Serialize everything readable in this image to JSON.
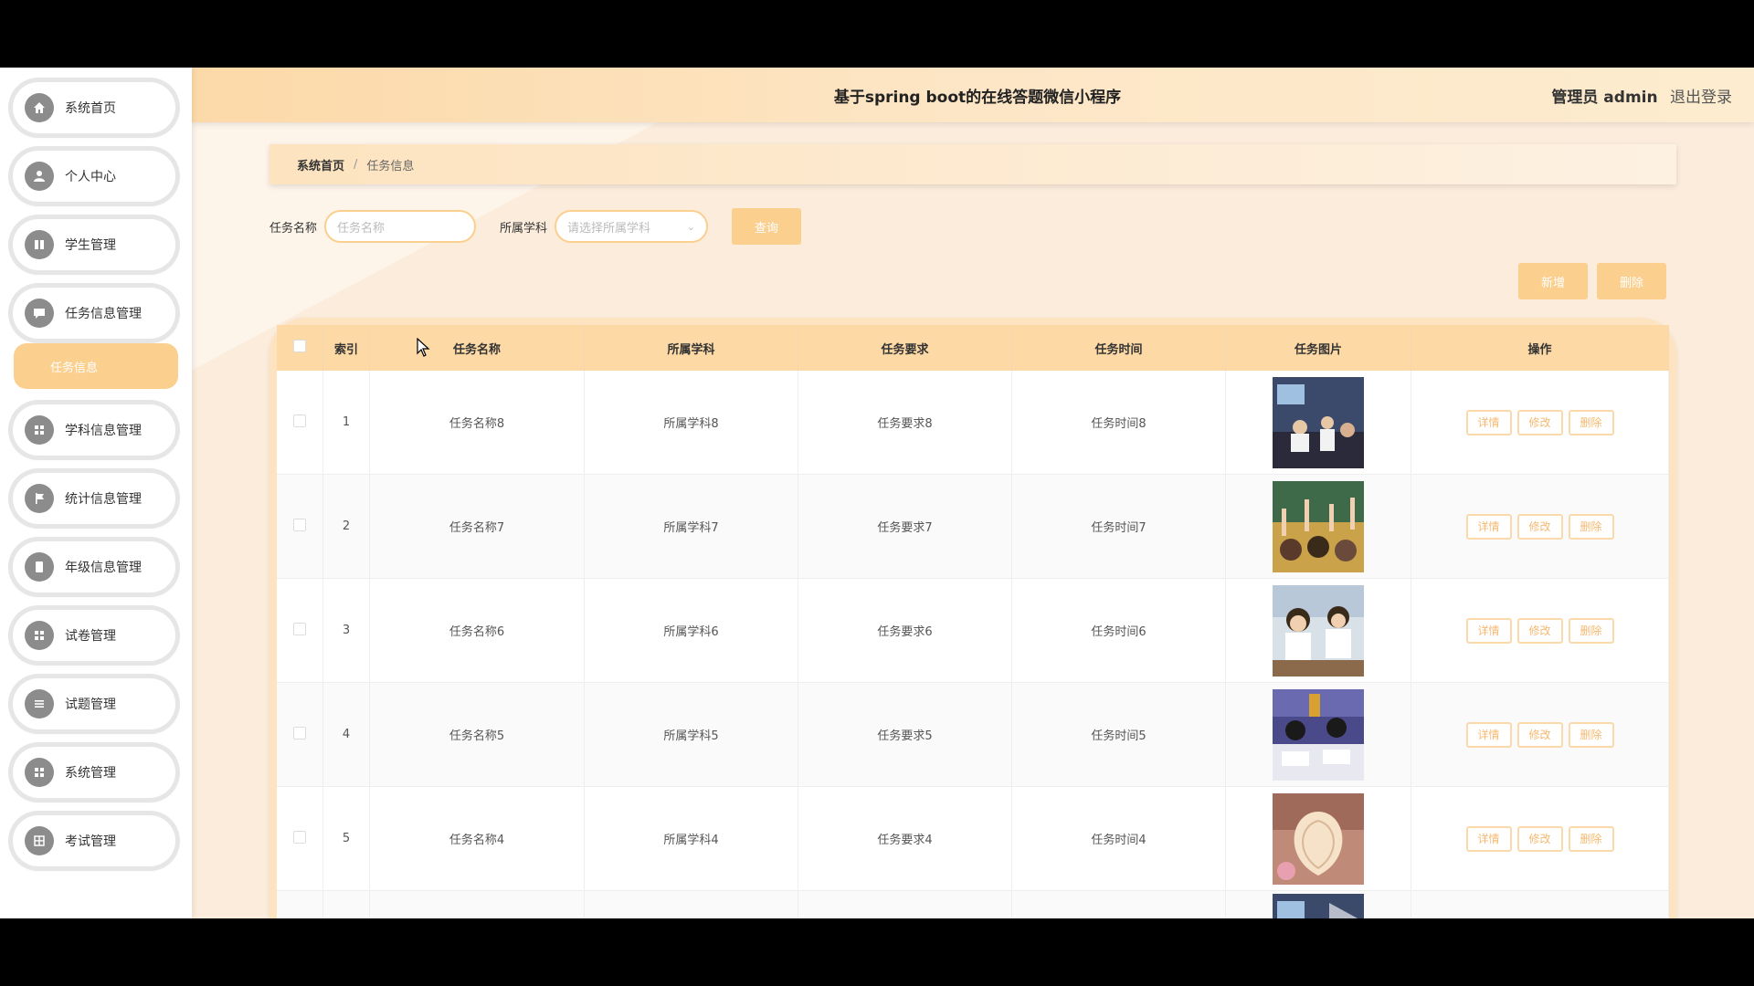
{
  "header": {
    "title": "基于spring boot的在线答题微信小程序",
    "role": "管理员 admin",
    "logout": "退出登录"
  },
  "sidebar": {
    "items": [
      {
        "label": "系统首页",
        "icon": "home-icon"
      },
      {
        "label": "个人中心",
        "icon": "user-icon"
      },
      {
        "label": "学生管理",
        "icon": "book-icon"
      },
      {
        "label": "任务信息管理",
        "icon": "chat-icon"
      },
      {
        "label": "学科信息管理",
        "icon": "grid-icon"
      },
      {
        "label": "统计信息管理",
        "icon": "flag-icon"
      },
      {
        "label": "年级信息管理",
        "icon": "clipboard-icon"
      },
      {
        "label": "试卷管理",
        "icon": "grid-icon"
      },
      {
        "label": "试题管理",
        "icon": "sliders-icon"
      },
      {
        "label": "系统管理",
        "icon": "grid-icon"
      },
      {
        "label": "考试管理",
        "icon": "table-icon"
      }
    ],
    "active_sub": "任务信息"
  },
  "breadcrumb": {
    "home": "系统首页",
    "separator": "/",
    "current": "任务信息"
  },
  "search": {
    "name_label": "任务名称",
    "name_placeholder": "任务名称",
    "subject_label": "所属学科",
    "subject_placeholder": "请选择所属学科",
    "query_button": "查询"
  },
  "actions": {
    "add": "新增",
    "delete": "删除"
  },
  "table": {
    "headers": [
      "索引",
      "任务名称",
      "所属学科",
      "任务要求",
      "任务时间",
      "任务图片",
      "操作"
    ],
    "rows": [
      {
        "index": "1",
        "name": "任务名称8",
        "subject": "所属学科8",
        "requirement": "任务要求8",
        "time": "任务时间8"
      },
      {
        "index": "2",
        "name": "任务名称7",
        "subject": "所属学科7",
        "requirement": "任务要求7",
        "time": "任务时间7"
      },
      {
        "index": "3",
        "name": "任务名称6",
        "subject": "所属学科6",
        "requirement": "任务要求6",
        "time": "任务时间6"
      },
      {
        "index": "4",
        "name": "任务名称5",
        "subject": "所属学科5",
        "requirement": "任务要求5",
        "time": "任务时间5"
      },
      {
        "index": "5",
        "name": "任务名称4",
        "subject": "所属学科4",
        "requirement": "任务要求4",
        "time": "任务时间4"
      }
    ],
    "row_ops": {
      "detail": "详情",
      "edit": "修改",
      "delete": "删除"
    }
  },
  "colors": {
    "accent": "#fbcf8e",
    "header_bg": "#fdd9a6",
    "page_bg": "#fdf0e2"
  }
}
